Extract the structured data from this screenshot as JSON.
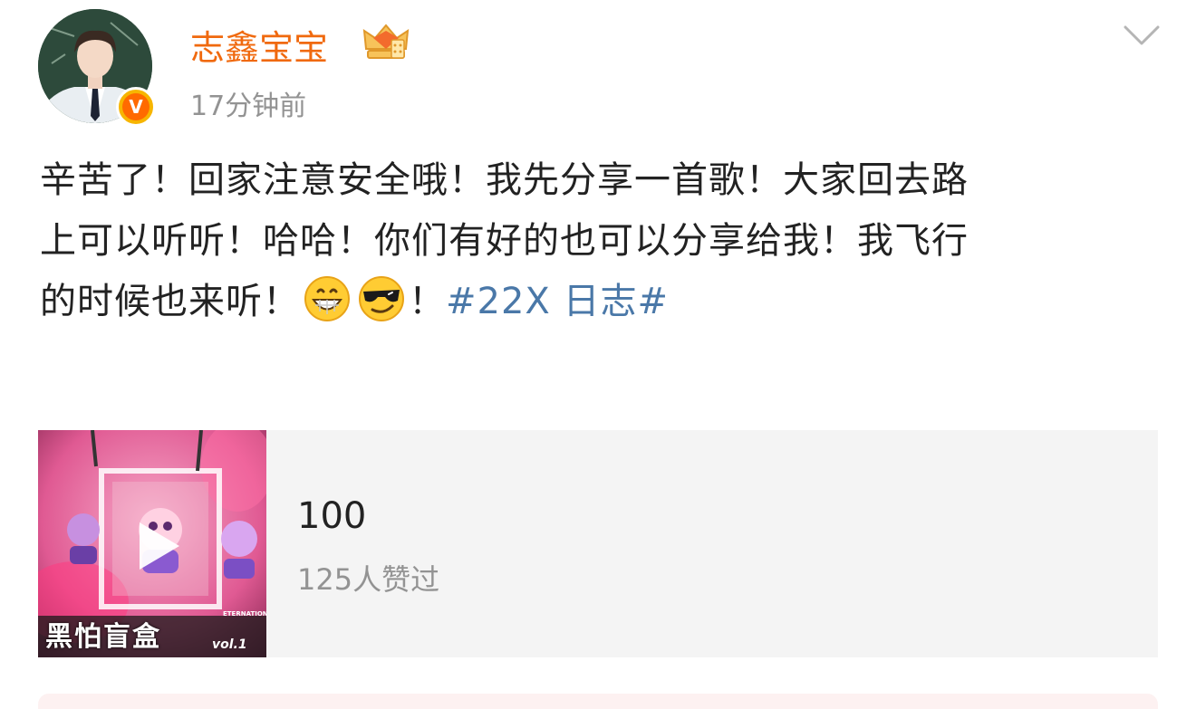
{
  "post": {
    "author": {
      "name": "志鑫宝宝",
      "verified_icon": "verified-v-badge",
      "vip_icon": "crown-vip-icon"
    },
    "timestamp": "17分钟前",
    "text_lines": [
      "辛苦了！回家注意安全哦！我先分享一首歌！大家回去路",
      "上可以听听！哈哈！你们有好的也可以分享给我！我飞行",
      "的时候也来听！"
    ],
    "text_after_emoji": "！",
    "emoji": [
      "grinning-face-emoji",
      "sunglasses-face-emoji"
    ],
    "hashtag": "#22X 日志#",
    "colors": {
      "username": "#f0690e",
      "hashtag": "#4a78a8",
      "muted": "#939393",
      "card_bg": "#f4f4f4"
    }
  },
  "music_card": {
    "cover_title": "黑怕盲盒",
    "cover_vol": "vol.1",
    "cover_brand": "ETERNATION",
    "song_name": "100",
    "likes": "125人赞过",
    "play_icon": "play-icon"
  }
}
